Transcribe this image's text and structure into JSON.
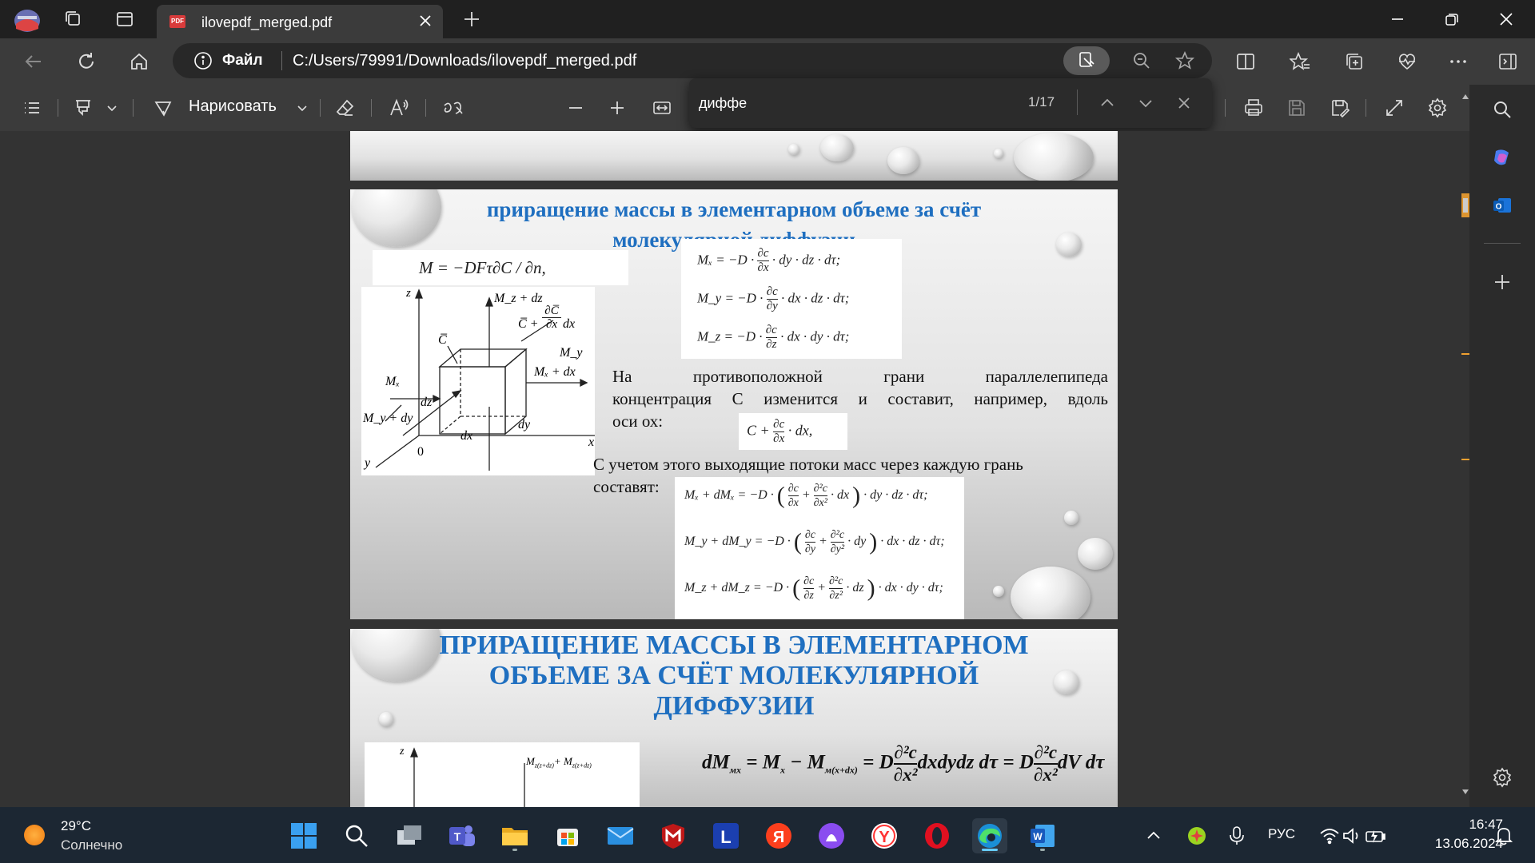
{
  "browser": {
    "tab_title": "ilovepdf_merged.pdf",
    "site_label": "Файл",
    "url": "C:/Users/79991/Downloads/ilovepdf_merged.pdf"
  },
  "pdf_toolbar": {
    "draw_label": "Нарисовать"
  },
  "find": {
    "query": "диффе",
    "count": "1/17"
  },
  "page2": {
    "title_line1": "приращение массы в элементарном объеме за счёт",
    "title_line2": "молекулярной диффузии",
    "eq_top": "M = −DFτ∂C / ∂n,",
    "fx_head": "Mₓ = −D ·",
    "fy_head": "M_y = −D ·",
    "fz_head": "M_z = −D ·",
    "fx_num": "∂c",
    "fx_den": "∂x",
    "fy_den": "∂y",
    "fz_den": "∂z",
    "fx_tail": "· dy · dz · dτ;",
    "fy_tail": "· dx · dz · dτ;",
    "fz_tail": "· dx · dy · dτ;",
    "para1_line1": "На противоположной грани параллелепипеда",
    "para1_line2": "концентрация С изменится и составит, например, вдоль",
    "para1_line3": "оси ох:",
    "c_formula_head": "C +",
    "c_formula_tail": "· dx,",
    "para2_line1": "С учетом этого выходящие потоки масс через каждую грань",
    "para2_line2": "составят:",
    "g1_head": "Mₓ + dMₓ = −D ·",
    "g2_head": "M_y + dM_y = −D ·",
    "g3_head": "M_z + dM_z = −D ·",
    "g_num1": "∂c",
    "g_num2": "∂²c",
    "g1_den1": "∂x",
    "g1_den2": "∂x²",
    "g2_den1": "∂y",
    "g2_den2": "∂y²",
    "g3_den1": "∂z",
    "g3_den2": "∂z²",
    "g1_mid": "· dx",
    "g2_mid": "· dy",
    "g3_mid": "· dz",
    "g1_tail": "· dy · dz · dτ;",
    "g2_tail": "· dx · dz · dτ;",
    "g3_tail": "· dx · dy · dτ;",
    "diagram": {
      "z": "z",
      "y": "y",
      "x": "x",
      "zero": "0",
      "mz_dz": "M_z + dz",
      "c_plus": "C̅ +",
      "c_frac_num": "∂C̅",
      "c_frac_den": "∂x",
      "c_dx": "dx",
      "c_bar": "C̅",
      "my": "M_y",
      "mx": "Mₓ",
      "mx_dx": "Mₓ + dx",
      "dz": "dz",
      "my_dy": "M_y + dy",
      "dy": "dy",
      "dx": "dx"
    }
  },
  "page3": {
    "title_line1": "ПРИРАЩЕНИЕ МАССЫ В ЭЛЕМЕНТАРНОМ",
    "title_line2": "ОБЪЕМЕ ЗА СЧЁТ МОЛЕКУЛЯРНОЙ",
    "title_line3": "ДИФФУЗИИ",
    "formula_a": "dM",
    "formula_a_sub": "мх",
    "formula_b": "= M",
    "formula_b_sub": "x",
    "formula_c": "− M",
    "formula_c_sub": "м(x+dx)",
    "formula_d": "= D",
    "frac_num": "∂²c",
    "frac_den": "∂x²",
    "formula_e": "dxdydz dτ = D",
    "formula_f": "dV dτ",
    "z_label": "z",
    "m_label": "M",
    "m_sub1": "z(z+dz)",
    "m_plus": "+ M",
    "m_sub2": "z(z+dz)"
  },
  "taskbar": {
    "temperature": "29°C",
    "weather": "Солнечно",
    "language": "РУС",
    "time": "16:47",
    "date": "13.06.2024"
  },
  "colors": {
    "accent": "#1f6fc0",
    "scroll_marker": "#f0a030",
    "tab_bg": "#3b3b3b",
    "titlebar_bg": "#202020"
  }
}
